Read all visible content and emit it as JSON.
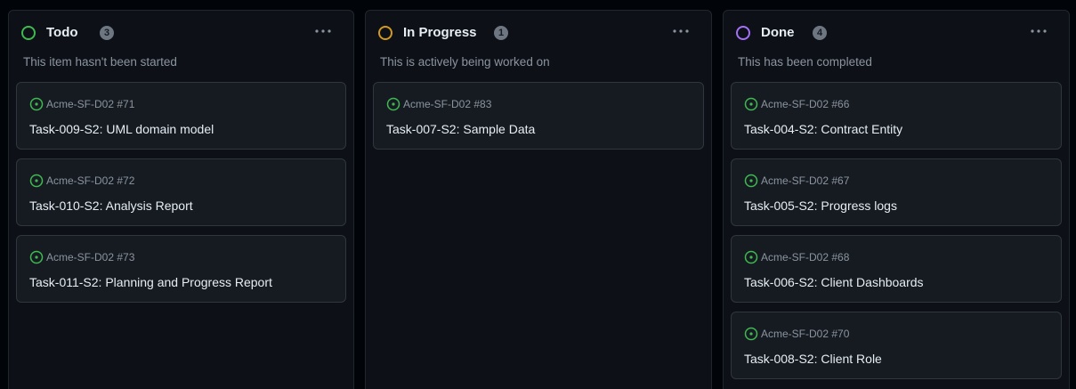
{
  "columns": [
    {
      "title": "Todo",
      "count": "3",
      "description": "This item hasn't been started",
      "color": "#3fb950",
      "cards": [
        {
          "repo": "Acme-SF-D02 #71",
          "title": "Task-009-S2: UML domain model"
        },
        {
          "repo": "Acme-SF-D02 #72",
          "title": "Task-010-S2: Analysis Report"
        },
        {
          "repo": "Acme-SF-D02 #73",
          "title": "Task-011-S2: Planning and Progress Report"
        }
      ]
    },
    {
      "title": "In Progress",
      "count": "1",
      "description": "This is actively being worked on",
      "color": "#d29922",
      "cards": [
        {
          "repo": "Acme-SF-D02 #83",
          "title": "Task-007-S2: Sample Data"
        }
      ]
    },
    {
      "title": "Done",
      "count": "4",
      "description": "This has been completed",
      "color": "#a371f7",
      "cards": [
        {
          "repo": "Acme-SF-D02 #66",
          "title": "Task-004-S2: Contract Entity"
        },
        {
          "repo": "Acme-SF-D02 #67",
          "title": "Task-005-S2: Progress logs"
        },
        {
          "repo": "Acme-SF-D02 #68",
          "title": "Task-006-S2: Client Dashboards"
        },
        {
          "repo": "Acme-SF-D02 #70",
          "title": "Task-008-S2: Client Role"
        }
      ]
    }
  ],
  "icons": {
    "issue_open": "issue-opened-icon",
    "more": "kebab-horizontal-icon"
  },
  "colors": {
    "issue_open": "#3fb950"
  }
}
